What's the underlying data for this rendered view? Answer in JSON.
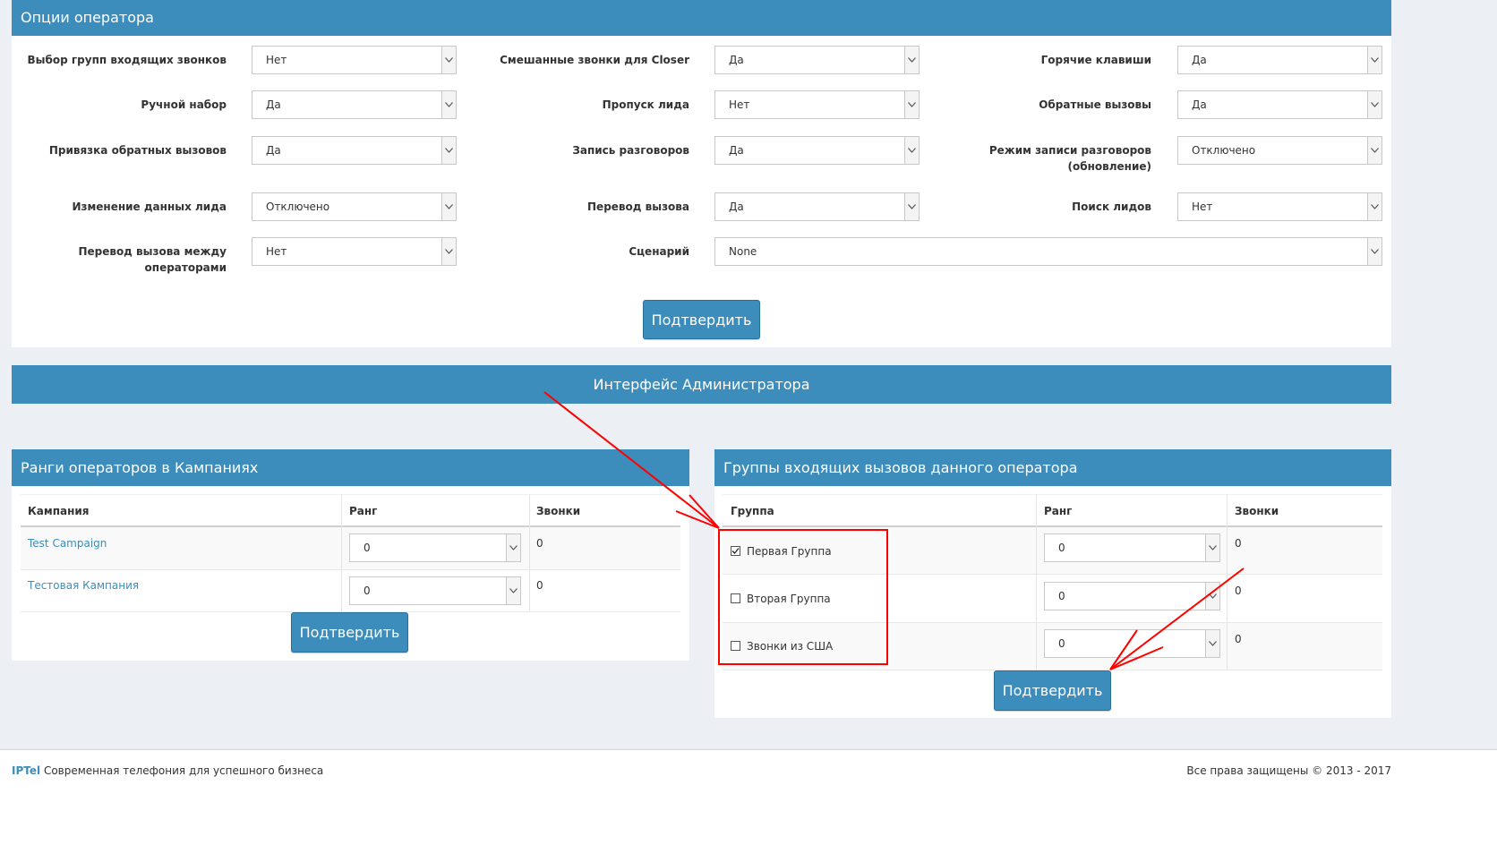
{
  "operator_options": {
    "title": "Опции оператора",
    "fields": [
      {
        "label": "Выбор групп входящих звонков",
        "value": "Нет"
      },
      {
        "label": "Смешанные звонки для Closer",
        "value": "Да"
      },
      {
        "label": "Горячие клавиши",
        "value": "Да"
      },
      {
        "label": "Ручной набор",
        "value": "Да"
      },
      {
        "label": "Пропуск лида",
        "value": "Нет"
      },
      {
        "label": "Обратные вызовы",
        "value": "Да"
      },
      {
        "label": "Привязка обратных вызовов",
        "value": "Да"
      },
      {
        "label": "Запись разговоров",
        "value": "Да"
      },
      {
        "label": "Режим записи разговоров",
        "label2": "(обновление)",
        "value": "Отключено"
      },
      {
        "label": "Изменение данных лида",
        "value": "Отключено"
      },
      {
        "label": "Перевод вызова",
        "value": "Да"
      },
      {
        "label": "Поиск лидов",
        "value": "Нет"
      },
      {
        "label": "Перевод вызова между операторами",
        "value": "Нет"
      },
      {
        "label": "Сценарий",
        "value": "None"
      }
    ],
    "submit_label": "Подтвердить"
  },
  "admin_interface": {
    "label": "Интерфейс Администратора"
  },
  "campaign_ranks": {
    "title": "Ранги операторов в Кампаниях",
    "columns": [
      "Кампания",
      "Ранг",
      "Звонки"
    ],
    "rows": [
      {
        "campaign": "Test Campaign",
        "rank": "0",
        "calls": "0"
      },
      {
        "campaign": "Тестовая Кампания",
        "rank": "0",
        "calls": "0"
      }
    ],
    "submit_label": "Подтвердить"
  },
  "inbound_groups": {
    "title": "Группы входящих вызовов данного оператора",
    "columns": [
      "Группа",
      "Ранг",
      "Звонки"
    ],
    "rows": [
      {
        "group": "Первая Группа",
        "checked": true,
        "rank": "0",
        "calls": "0"
      },
      {
        "group": "Вторая Группа",
        "checked": false,
        "rank": "0",
        "calls": "0"
      },
      {
        "group": "Звонки из США",
        "checked": false,
        "rank": "0",
        "calls": "0"
      }
    ],
    "submit_label": "Подтвердить"
  },
  "footer": {
    "brand": "IPTel",
    "tagline": "Современная телефония для успешного бизнеса",
    "copyright": "Все права защищены © 2013 - 2017"
  },
  "colors": {
    "accent": "#3c8dbc",
    "annotation": "#ff0000"
  },
  "icons": {
    "select_arrow": "chevron-down-icon",
    "checked": "checkmark-icon"
  }
}
